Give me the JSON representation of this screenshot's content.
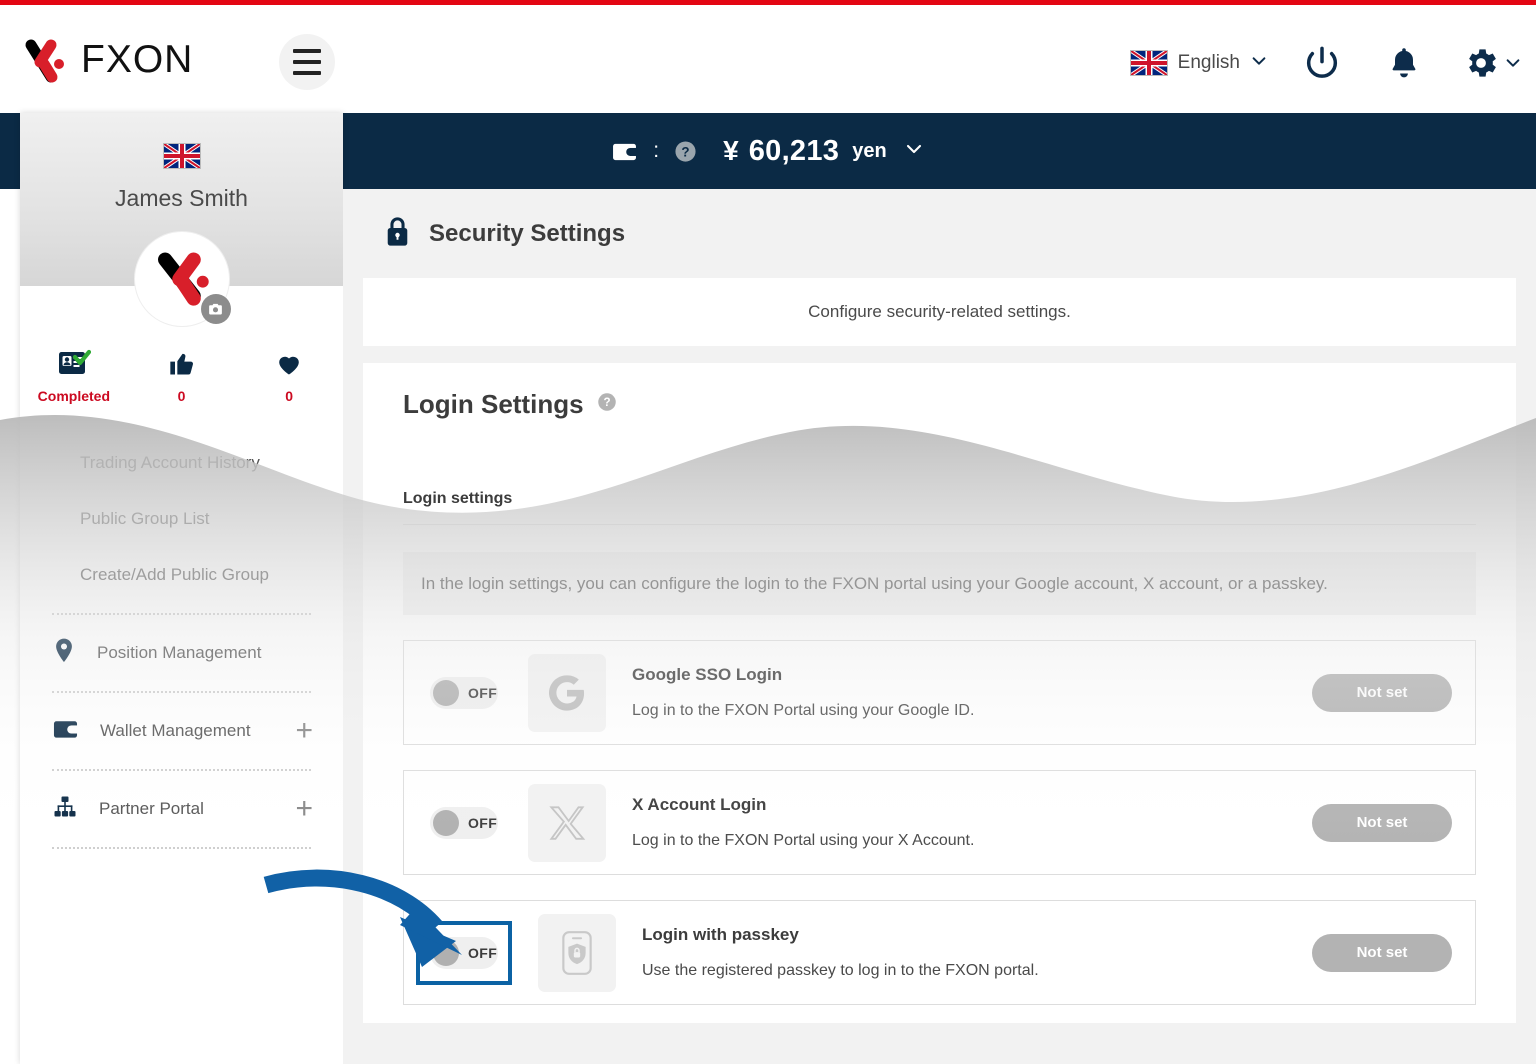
{
  "brand": {
    "name": "FXON",
    "accent_red": "#e30613",
    "navy": "#0b2a45"
  },
  "header": {
    "menu_icon": "hamburger-icon",
    "language": {
      "label": "English",
      "flag": "uk-flag",
      "chevron": "chevron-down-icon"
    },
    "power_icon": "power-icon",
    "bell_icon": "bell-icon",
    "gear_icon": "gear-icon",
    "gear_chevron": "chevron-down-icon"
  },
  "balance_bar": {
    "wallet_icon": "wallet-icon",
    "separator": ":",
    "help_icon": "help-circle-icon",
    "currency_symbol": "¥",
    "amount": "60,213",
    "unit": "yen",
    "chevron": "chevron-down-icon"
  },
  "sidebar": {
    "flag": "uk-flag",
    "user_name": "James Smith",
    "avatar": "fxon-avatar",
    "camera_icon": "camera-icon",
    "stats": [
      {
        "icon": "id-card-check-icon",
        "label": "Completed"
      },
      {
        "icon": "thumbs-up-icon",
        "label": "0"
      },
      {
        "icon": "heart-icon",
        "label": "0"
      }
    ],
    "items": [
      {
        "label": "Trading Account History",
        "icon": null,
        "plus": false
      },
      {
        "label": "Public Group List",
        "icon": null,
        "plus": false
      },
      {
        "label": "Create/Add Public Group",
        "icon": null,
        "plus": false
      },
      {
        "label": "Position Management",
        "icon": "location-pin-icon",
        "plus": false
      },
      {
        "label": "Wallet Management",
        "icon": "wallet-icon",
        "plus": true
      },
      {
        "label": "Partner Portal",
        "icon": "org-chart-icon",
        "plus": true
      }
    ]
  },
  "main": {
    "page_icon": "lock-icon",
    "page_title": "Security Settings",
    "page_description": "Configure security-related settings.",
    "panel_title": "Login Settings",
    "panel_help_icon": "help-circle-icon",
    "section_label": "Login settings",
    "notice": "In the login settings, you can configure the login to the FXON portal using your Google account, X account, or a passkey.",
    "rows": [
      {
        "toggle_state": "OFF",
        "toggle_highlighted": false,
        "icon": "google-g-icon",
        "name": "Google SSO Login",
        "description": "Log in to the FXON Portal using your Google ID.",
        "action_label": "Not set"
      },
      {
        "toggle_state": "OFF",
        "toggle_highlighted": false,
        "icon": "x-logo-icon",
        "name": "X Account Login",
        "description": "Log in to the FXON Portal using your X Account.",
        "action_label": "Not set"
      },
      {
        "toggle_state": "OFF",
        "toggle_highlighted": true,
        "icon": "phone-passkey-icon",
        "name": "Login with passkey",
        "description": "Use the registered passkey to log in to the FXON portal.",
        "action_label": "Not set"
      }
    ]
  },
  "annotation": {
    "arrow_color": "#1161a6",
    "highlight_color": "#0b62a4",
    "target": "passkey-toggle"
  }
}
